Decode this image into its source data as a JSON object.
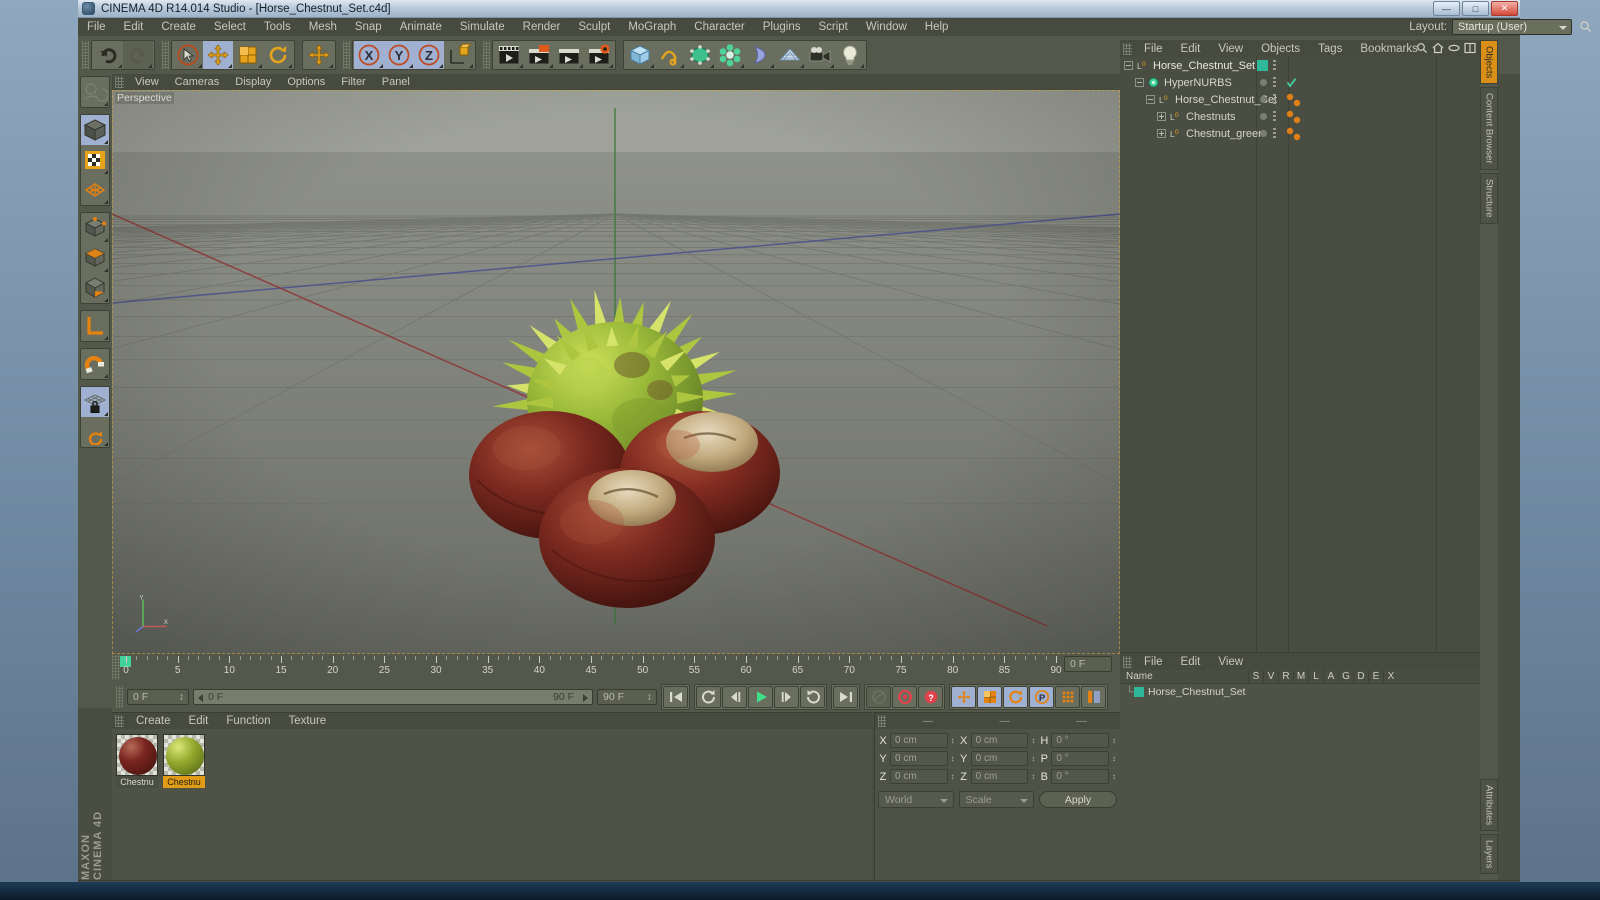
{
  "window": {
    "title": "CINEMA 4D R14.014 Studio - [Horse_Chestnut_Set.c4d]",
    "app_icon": "c4d-logo-icon",
    "buttons": {
      "minimize": "—",
      "maximize": "□",
      "close": "✕"
    }
  },
  "menubar": {
    "items": [
      "File",
      "Edit",
      "Create",
      "Select",
      "Tools",
      "Mesh",
      "Snap",
      "Animate",
      "Simulate",
      "Render",
      "Sculpt",
      "MoGraph",
      "Character",
      "Plugins",
      "Script",
      "Window",
      "Help"
    ],
    "layout_label": "Layout:",
    "layout_value": "Startup (User)",
    "search_icon": "search-icon"
  },
  "toolbar": {
    "groups": [
      {
        "name": "undo-redo",
        "buttons": [
          {
            "icon": "undo-icon",
            "state": "normal"
          },
          {
            "icon": "redo-icon",
            "state": "disabled"
          }
        ]
      },
      {
        "name": "transform-modes",
        "buttons": [
          {
            "icon": "select-cursor-icon",
            "state": "normal"
          },
          {
            "icon": "move-icon",
            "state": "selected"
          },
          {
            "icon": "scale-icon",
            "state": "normal"
          },
          {
            "icon": "rotate-icon",
            "state": "normal"
          }
        ]
      },
      {
        "name": "add-tool",
        "buttons": [
          {
            "icon": "plus-move-icon",
            "state": "normal"
          }
        ]
      },
      {
        "name": "axis-locks",
        "buttons": [
          {
            "icon": "axis-x-icon",
            "state": "selected"
          },
          {
            "icon": "axis-y-icon",
            "state": "selected"
          },
          {
            "icon": "axis-z-icon",
            "state": "selected"
          },
          {
            "icon": "world-object-axis-icon",
            "state": "normal"
          }
        ]
      },
      {
        "name": "render-group",
        "buttons": [
          {
            "icon": "render-view-icon",
            "state": "normal"
          },
          {
            "icon": "render-region-icon",
            "state": "normal"
          },
          {
            "icon": "render-to-picture-viewer-icon",
            "state": "normal"
          },
          {
            "icon": "render-settings-icon",
            "state": "normal"
          }
        ]
      },
      {
        "name": "object-creation",
        "buttons": [
          {
            "icon": "cube-primitive-icon",
            "state": "normal"
          },
          {
            "icon": "spline-pen-icon",
            "state": "normal"
          },
          {
            "icon": "generator-nurbs-icon",
            "state": "normal"
          },
          {
            "icon": "mograph-array-icon",
            "state": "normal"
          },
          {
            "icon": "deformer-bend-icon",
            "state": "normal"
          },
          {
            "icon": "scene-floor-icon",
            "state": "normal"
          },
          {
            "icon": "camera-icon",
            "state": "normal"
          },
          {
            "icon": "light-icon",
            "state": "normal"
          }
        ]
      }
    ]
  },
  "left_toolbar": {
    "buttons": [
      {
        "icon": "make-editable-icon",
        "state": "normal"
      },
      {
        "icon": "model-mode-icon",
        "state": "selected"
      },
      {
        "icon": "texture-mode-icon",
        "state": "normal"
      },
      {
        "icon": "points-mode-icon",
        "state": "normal"
      },
      {
        "icon": "edges-mode-icon",
        "state": "normal"
      },
      {
        "icon": "polygons-mode-icon",
        "state": "normal"
      },
      {
        "icon": "axis-mode-icon",
        "state": "normal"
      },
      {
        "icon": "enable-axis-icon",
        "state": "normal"
      },
      {
        "icon": "magnet-icon",
        "state": "normal"
      },
      {
        "icon": "lock-workplane-icon",
        "state": "selected"
      },
      {
        "icon": "workplane-rotate-icon",
        "state": "normal"
      }
    ]
  },
  "viewport": {
    "menu": [
      "View",
      "Cameras",
      "Display",
      "Options",
      "Filter",
      "Panel"
    ],
    "label": "Perspective",
    "gizmo_axes": [
      "Y",
      "X",
      "Z"
    ],
    "scene_objects": [
      "Horse_Chestnut_Set",
      "Chestnuts",
      "Chestnut_green"
    ]
  },
  "timeline": {
    "ticks": [
      0,
      5,
      10,
      15,
      20,
      25,
      30,
      35,
      40,
      45,
      50,
      55,
      60,
      65,
      70,
      75,
      80,
      85,
      90
    ],
    "current_frame_marker": "0",
    "current_frame_field": "0 F",
    "range_start_field": "0 F",
    "range_preview_field": "90 F",
    "range_end_field": "90 F",
    "max_frame_badge": "90",
    "frame_readout": "0 F",
    "transport": [
      {
        "icon": "go-to-start-icon"
      },
      {
        "icon": "loop-icon"
      },
      {
        "icon": "step-back-icon"
      },
      {
        "icon": "play-icon"
      },
      {
        "icon": "step-forward-icon"
      },
      {
        "icon": "play-reverse-icon"
      },
      {
        "icon": "go-to-end-icon"
      }
    ],
    "record_group": [
      {
        "icon": "autokey-icon",
        "state": "disabled"
      },
      {
        "icon": "record-active-objects-icon",
        "state": "normal"
      },
      {
        "icon": "keyframe-selection-icon",
        "state": "normal"
      }
    ],
    "key_toggles": [
      {
        "icon": "key-position-icon",
        "state": "selected"
      },
      {
        "icon": "key-scale-icon",
        "state": "selected"
      },
      {
        "icon": "key-rotation-icon",
        "state": "selected"
      },
      {
        "icon": "key-param-icon",
        "state": "selected"
      },
      {
        "icon": "key-pla-icon",
        "state": "normal"
      },
      {
        "icon": "keyframe-settings-icon",
        "state": "normal"
      }
    ]
  },
  "material_manager": {
    "menu": [
      "Create",
      "Edit",
      "Function",
      "Texture"
    ],
    "materials": [
      {
        "name": "Chestnu",
        "color": "#6d1f1c",
        "selected": false
      },
      {
        "name": "Chestnu",
        "color": "#8fa22a",
        "selected": true
      }
    ]
  },
  "coordinates": {
    "headers": [
      "—",
      "—",
      "—"
    ],
    "rows": [
      {
        "pos_label": "X",
        "pos_value": "0 cm",
        "size_label": "X",
        "size_value": "0 cm",
        "rot_label": "H",
        "rot_value": "0 °"
      },
      {
        "pos_label": "Y",
        "pos_value": "0 cm",
        "size_label": "Y",
        "size_value": "0 cm",
        "rot_label": "P",
        "rot_value": "0 °"
      },
      {
        "pos_label": "Z",
        "pos_value": "0 cm",
        "size_label": "Z",
        "size_value": "0 cm",
        "rot_label": "B",
        "rot_value": "0 °"
      }
    ],
    "system_select": "World",
    "mode_select": "Scale",
    "apply_button": "Apply"
  },
  "object_manager": {
    "menu": [
      "File",
      "Edit",
      "View",
      "Objects",
      "Tags",
      "Bookmarks"
    ],
    "header_icons": [
      "search-icon",
      "home-icon",
      "ellipse-icon",
      "layout-icon"
    ],
    "items": [
      {
        "name": "Horse_Chestnut_Set",
        "depth": 0,
        "expander": "minus",
        "icon": "null-object-icon",
        "selected": true,
        "dot": "teal",
        "tags": []
      },
      {
        "name": "HyperNURBS",
        "depth": 1,
        "expander": "minus",
        "icon": "hypernurbs-icon",
        "selected": false,
        "dot": "grey",
        "tags": [
          "check"
        ]
      },
      {
        "name": "Horse_Chestnut_Set",
        "depth": 2,
        "expander": "minus",
        "icon": "null-object-icon",
        "selected": false,
        "dot": "grey",
        "tags": [
          "material",
          "material"
        ]
      },
      {
        "name": "Chestnuts",
        "depth": 3,
        "expander": "plus",
        "icon": "null-object-icon",
        "selected": false,
        "dot": "grey",
        "tags": [
          "material",
          "material"
        ]
      },
      {
        "name": "Chestnut_green",
        "depth": 3,
        "expander": "plus",
        "icon": "null-object-icon",
        "selected": false,
        "dot": "grey",
        "tags": [
          "material",
          "material"
        ]
      }
    ]
  },
  "bottom_right_panel": {
    "menu": [
      "File",
      "Edit",
      "View"
    ],
    "columns": [
      "Name",
      "S",
      "V",
      "R",
      "M",
      "L",
      "A",
      "G",
      "D",
      "E",
      "X"
    ],
    "rows": [
      {
        "name": "Horse_Chestnut_Set",
        "color": "#2fb79a"
      }
    ]
  },
  "vertical_tabs": [
    {
      "label": "Objects",
      "active": true
    },
    {
      "label": "Content Browser",
      "active": false
    },
    {
      "label": "Structure",
      "active": false
    },
    {
      "label": "Attributes",
      "active": false
    },
    {
      "label": "Layers",
      "active": false
    }
  ],
  "brand": "MAXON CINEMA 4D",
  "colors": {
    "accent_orange": "#e09b17",
    "selection_blue": "#9fb0d0",
    "panel_bg": "#4f5345",
    "toolbar_bg": "#54584a",
    "viewport_sky": "#9b9e95",
    "teal": "#2fb79a"
  }
}
